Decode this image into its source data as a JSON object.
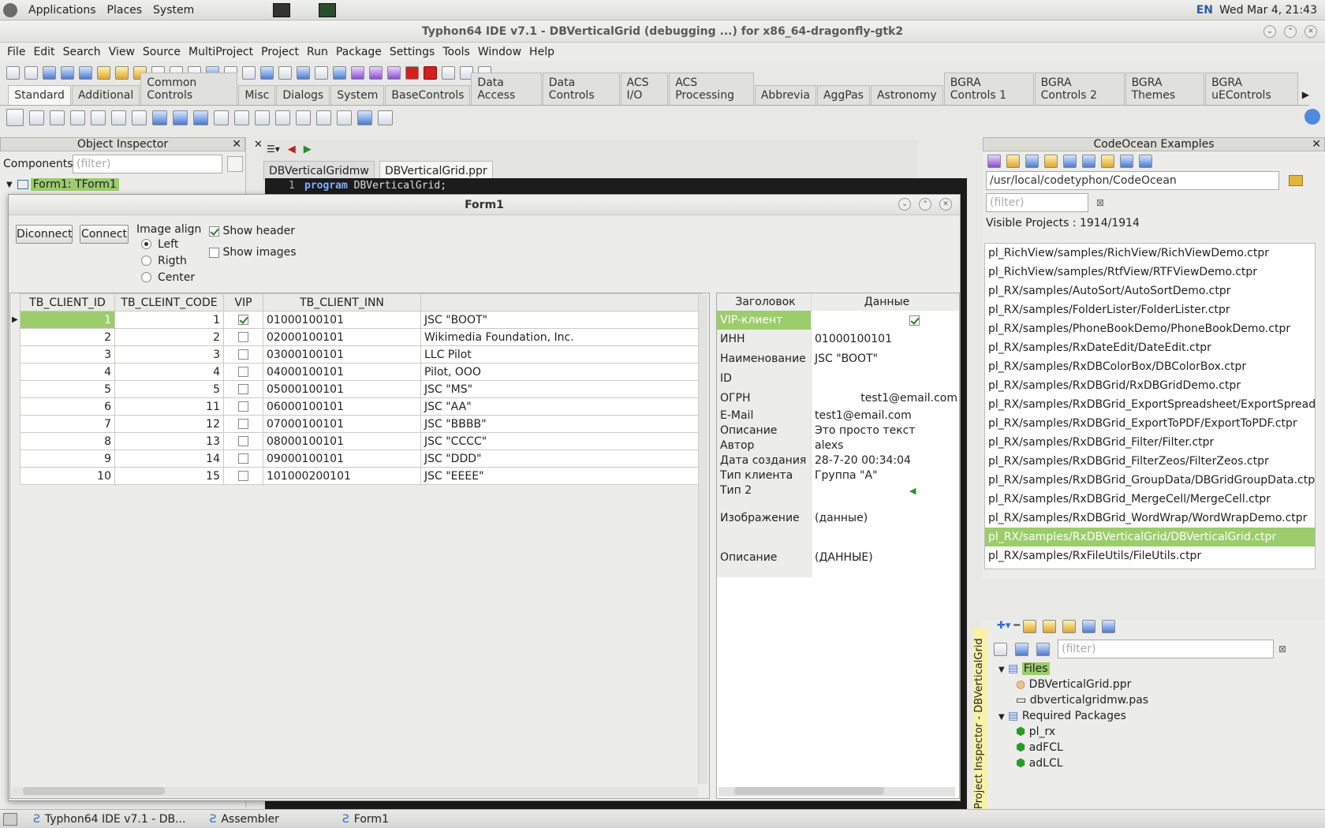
{
  "desktop": {
    "menus": [
      "Applications",
      "Places",
      "System"
    ],
    "lang": "EN",
    "clock": "Wed Mar  4, 21:43"
  },
  "window": {
    "title": "Typhon64 IDE v7.1 - DBVerticalGrid (debugging ...) for x86_64-dragonfly-gtk2"
  },
  "menubar": [
    "File",
    "Edit",
    "Search",
    "View",
    "Source",
    "MultiProject",
    "Project",
    "Run",
    "Package",
    "Settings",
    "Tools",
    "Window",
    "Help"
  ],
  "palette_tabs": [
    "Standard",
    "Additional",
    "Common Controls",
    "Misc",
    "Dialogs",
    "System",
    "BaseControls",
    "Data Access",
    "Data Controls",
    "ACS I/O",
    "ACS Processing",
    "Abbrevia",
    "AggPas",
    "Astronomy",
    "BGRA Controls 1",
    "BGRA Controls 2",
    "BGRA Themes",
    "BGRA uEControls"
  ],
  "object_inspector": {
    "title": "Object Inspector",
    "components_label": "Components",
    "filter_placeholder": "(filter)",
    "tree_root": "Form1: TForm1"
  },
  "editor": {
    "tabs": [
      "DBVerticalGridmw",
      "DBVerticalGrid.ppr"
    ],
    "line_no": "1",
    "code_kw": "program",
    "code_rest": " DBVerticalGrid;"
  },
  "codeocean": {
    "title": "CodeOcean Examples",
    "path": "/usr/local/codetyphon/CodeOcean",
    "filter_placeholder": "(filter)",
    "visible_projects": "Visible Projects : 1914/1914",
    "projects": [
      "pl_RichView/samples/RichView/RichViewDemo.ctpr",
      "pl_RichView/samples/RtfView/RTFViewDemo.ctpr",
      "pl_RX/samples/AutoSort/AutoSortDemo.ctpr",
      "pl_RX/samples/FolderLister/FolderLister.ctpr",
      "pl_RX/samples/PhoneBookDemo/PhoneBookDemo.ctpr",
      "pl_RX/samples/RxDateEdit/DateEdit.ctpr",
      "pl_RX/samples/RxDBColorBox/DBColorBox.ctpr",
      "pl_RX/samples/RxDBGrid/RxDBGridDemo.ctpr",
      "pl_RX/samples/RxDBGrid_ExportSpreadsheet/ExportSpreadshee",
      "pl_RX/samples/RxDBGrid_ExportToPDF/ExportToPDF.ctpr",
      "pl_RX/samples/RxDBGrid_Filter/Filter.ctpr",
      "pl_RX/samples/RxDBGrid_FilterZeos/FilterZeos.ctpr",
      "pl_RX/samples/RxDBGrid_GroupData/DBGridGroupData.ctpr",
      "pl_RX/samples/RxDBGrid_MergeCell/MergeCell.ctpr",
      "pl_RX/samples/RxDBGrid_WordWrap/WordWrapDemo.ctpr",
      "pl_RX/samples/RxDBVerticalGrid/DBVerticalGrid.ctpr",
      "pl_RX/samples/RxFileUtils/FileUtils.ctpr"
    ],
    "selected_index": 15
  },
  "project_inspector": {
    "side_label": "Project Inspector - DBVerticalGrid",
    "filter_placeholder": "(filter)",
    "files_label": "Files",
    "files": [
      "DBVerticalGrid.ppr",
      "dbverticalgridmw.pas"
    ],
    "required_label": "Required Packages",
    "packages": [
      "pl_rx",
      "adFCL",
      "adLCL"
    ]
  },
  "form1": {
    "title": "Form1",
    "disconnect": "Diconnect",
    "connect": "Connect",
    "image_align_label": "Image align",
    "align_options": [
      "Left",
      "Rigth",
      "Center"
    ],
    "show_header": "Show header",
    "show_images": "Show images",
    "grid": {
      "columns": [
        "TB_CLIENT_ID",
        "TB_CLEINT_CODE",
        "VIP",
        "TB_CLIENT_INN",
        ""
      ],
      "rows": [
        {
          "id": "1",
          "code": "1",
          "vip": true,
          "inn": "01000100101",
          "name": "JSC \"BOOT\""
        },
        {
          "id": "2",
          "code": "2",
          "vip": false,
          "inn": "02000100101",
          "name": "Wikimedia Foundation, Inc."
        },
        {
          "id": "3",
          "code": "3",
          "vip": false,
          "inn": "03000100101",
          "name": "LLC Pilot"
        },
        {
          "id": "4",
          "code": "4",
          "vip": false,
          "inn": "04000100101",
          "name": "Pilot, OOO"
        },
        {
          "id": "5",
          "code": "5",
          "vip": false,
          "inn": "05000100101",
          "name": "JSC \"MS\""
        },
        {
          "id": "6",
          "code": "11",
          "vip": false,
          "inn": "06000100101",
          "name": "JSC \"AA\""
        },
        {
          "id": "7",
          "code": "12",
          "vip": false,
          "inn": "07000100101",
          "name": "JSC \"BBBB\""
        },
        {
          "id": "8",
          "code": "13",
          "vip": false,
          "inn": "08000100101",
          "name": "JSC \"CCCC\""
        },
        {
          "id": "9",
          "code": "14",
          "vip": false,
          "inn": "09000100101",
          "name": "JSC \"DDD\""
        },
        {
          "id": "10",
          "code": "15",
          "vip": false,
          "inn": "101000200101",
          "name": "JSC \"EEEE\""
        }
      ]
    },
    "vgrid": {
      "head_key": "Заголовок",
      "head_val": "Данные",
      "rows": [
        {
          "k": "VIP-клиент",
          "v": ""
        },
        {
          "k": "ИНН",
          "v": "01000100101"
        },
        {
          "k": "Наименование",
          "v": "JSC \"BOOT\""
        },
        {
          "k": "ID",
          "v": ""
        },
        {
          "k": "ОГРН",
          "v": "test1@email.com"
        },
        {
          "k": "E-Mail",
          "v": "test1@email.com"
        },
        {
          "k": "Описание",
          "v": "Это просто текст"
        },
        {
          "k": "Автор",
          "v": "alexs"
        },
        {
          "k": "Дата создания",
          "v": "28-7-20 00:34:04"
        },
        {
          "k": "Тип клиента",
          "v": "Группа \"А\""
        },
        {
          "k": "Тип 2",
          "v": ""
        },
        {
          "k": "Изображение",
          "v": "(данные)"
        },
        {
          "k": "Описание",
          "v": "(ДАННЫЕ)"
        }
      ]
    }
  },
  "taskbar": [
    "Typhon64 IDE v7.1 - DB...",
    "Assembler",
    "Form1"
  ]
}
